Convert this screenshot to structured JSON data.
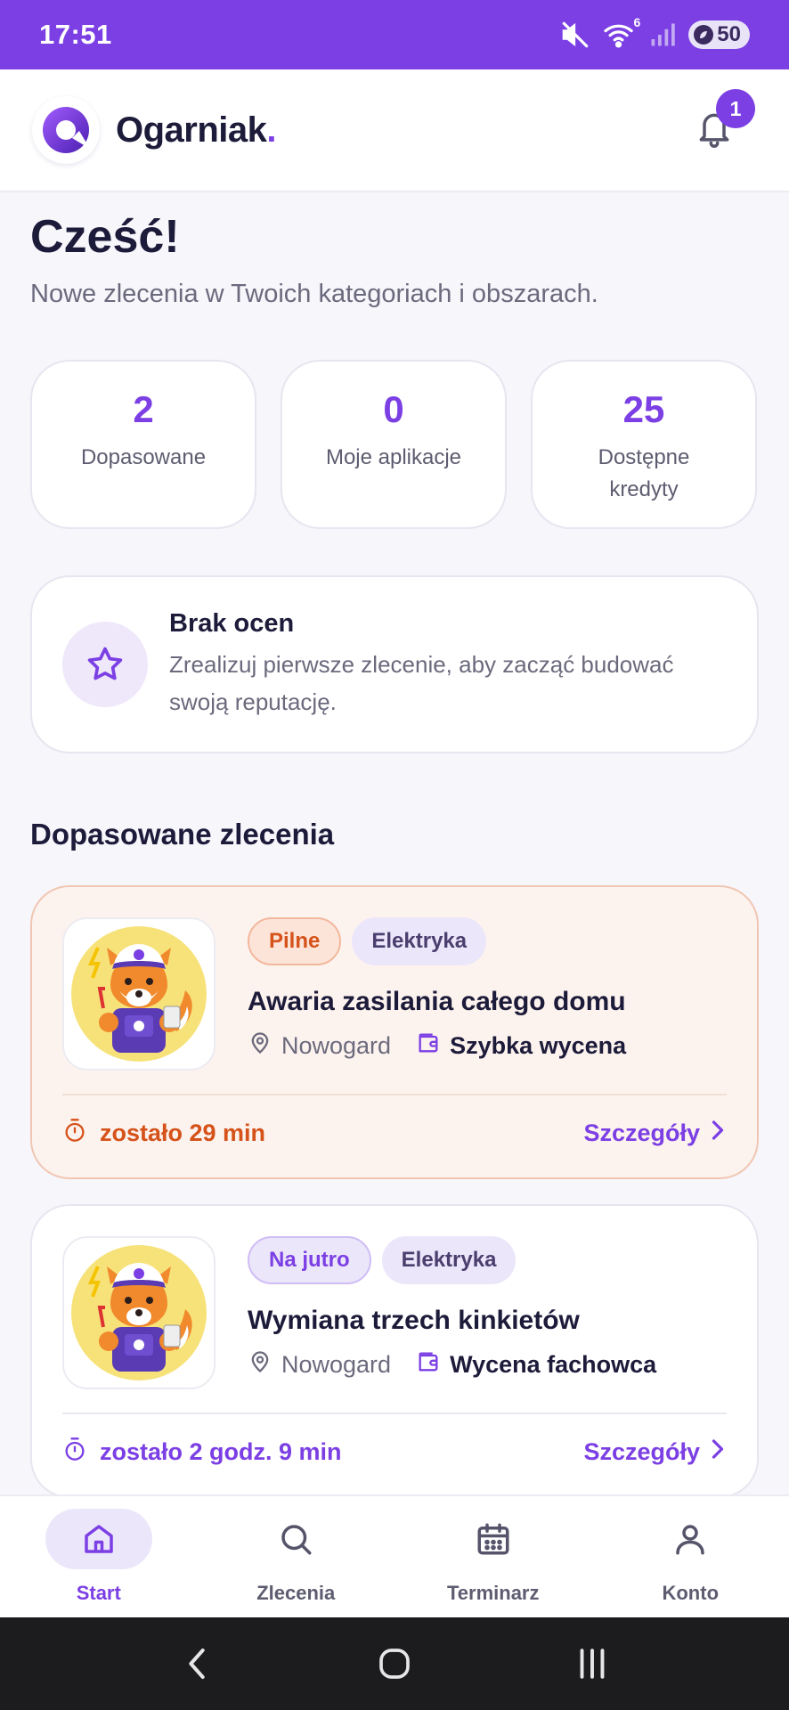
{
  "status_bar": {
    "time": "17:51",
    "wifi_badge": "6",
    "battery": "50",
    "icons": [
      "mute-icon",
      "wifi-icon",
      "signal-icon",
      "battery-icon"
    ]
  },
  "header": {
    "brand_name": "Ogarniak",
    "brand_dot": ".",
    "notification_count": "1"
  },
  "greeting": {
    "title": "Cześć!",
    "subtitle": "Nowe zlecenia w Twoich kategoriach i obszarach."
  },
  "stats": [
    {
      "value": "2",
      "label": "Dopasowane"
    },
    {
      "value": "0",
      "label": "Moje aplikacje"
    },
    {
      "value": "25",
      "label": "Dostępne kredyty"
    }
  ],
  "rating": {
    "title": "Brak ocen",
    "description": "Zrealizuj pierwsze zlecenie, aby zacząć budować swoją reputację."
  },
  "section": {
    "title": "Dopasowane zlecenia"
  },
  "jobs": [
    {
      "tag_priority": "Pilne",
      "tag_category": "Elektryka",
      "title": "Awaria zasilania całego domu",
      "location": "Nowogard",
      "price": "Szybka wycena",
      "time_left": "zostało 29 min",
      "details_label": "Szczegóły"
    },
    {
      "tag_priority": "Na jutro",
      "tag_category": "Elektryka",
      "title": "Wymiana trzech kinkietów",
      "location": "Nowogard",
      "price": "Wycena fachowca",
      "time_left": "zostało 2 godz. 9 min",
      "details_label": "Szczegóły"
    }
  ],
  "nav": [
    {
      "label": "Start",
      "icon": "home-icon",
      "active": true
    },
    {
      "label": "Zlecenia",
      "icon": "search-icon",
      "active": false
    },
    {
      "label": "Terminarz",
      "icon": "calendar-icon",
      "active": false
    },
    {
      "label": "Konto",
      "icon": "user-icon",
      "active": false
    }
  ],
  "colors": {
    "accent": "#7b3fe4",
    "urgent": "#d5521a",
    "text": "#1d1b3a",
    "muted": "#6b6a7d"
  }
}
